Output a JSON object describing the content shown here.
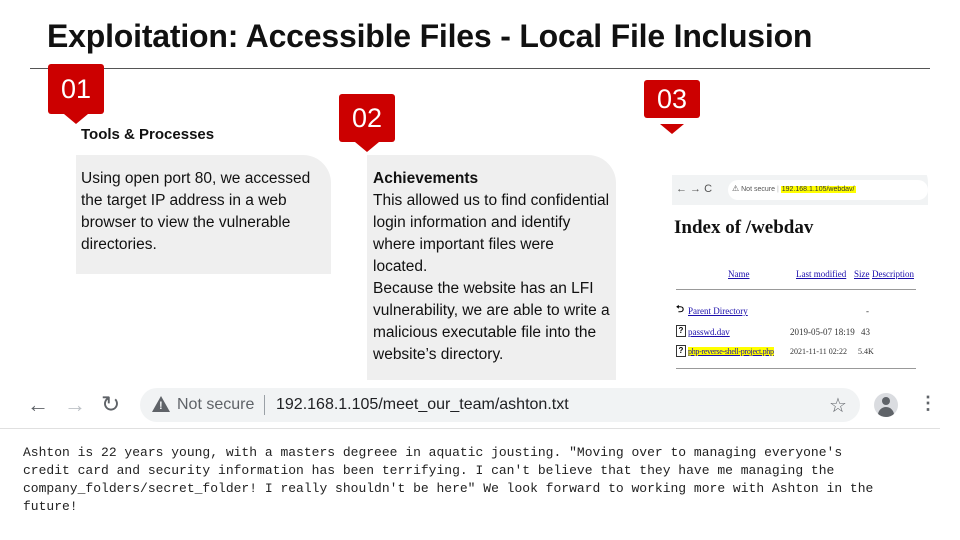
{
  "slide": {
    "title": "Exploitation: Accessible Files - Local File Inclusion",
    "badges": [
      "01",
      "02",
      "03"
    ]
  },
  "section1": {
    "heading": "Tools & Processes",
    "text": "Using open port 80, we accessed the target IP address in a web browser to view the vulnerable directories."
  },
  "section2": {
    "heading": "Achievements",
    "para1": "This allowed us to find confidential login information and identify where important files were located.",
    "para2": "Because the website has an LFI vulnerability, we are able to write a malicious executable file into the website’s directory."
  },
  "mini_browser": {
    "nav": "← → C",
    "security": "Not secure",
    "url": "192.168.1.105/webdav/",
    "heading": "Index of /webdav",
    "columns": [
      "Name",
      "Last modified",
      "Size",
      "Description"
    ],
    "rows": [
      {
        "name": "Parent Directory",
        "modified": "",
        "size": "-"
      },
      {
        "name": "passwd.dav",
        "modified": "2019-05-07 18:19",
        "size": "43"
      },
      {
        "name": "php-reverse-shell-project.php",
        "modified": "2021-11-11 02:22",
        "size": "5.4K"
      }
    ]
  },
  "browser": {
    "security_label": "Not secure",
    "url": "192.168.1.105/meet_our_team/ashton.txt",
    "page_text": "Ashton is 22 years young, with a masters degreee in aquatic jousting. \"Moving over to managing everyone's\ncredit card and security information has been terrifying. I can't believe that they have me managing the\ncompany_folders/secret_folder! I really shouldn't be here\" We look forward to working more with Ashton in the\nfuture!"
  },
  "colors": {
    "badge": "#cc0000",
    "card": "#efefef",
    "highlight": "#ffff00"
  },
  "icons": [
    "back-arrow-icon",
    "forward-arrow-icon",
    "reload-icon",
    "warning-icon",
    "star-icon",
    "profile-icon",
    "menu-icon",
    "file-icon"
  ]
}
